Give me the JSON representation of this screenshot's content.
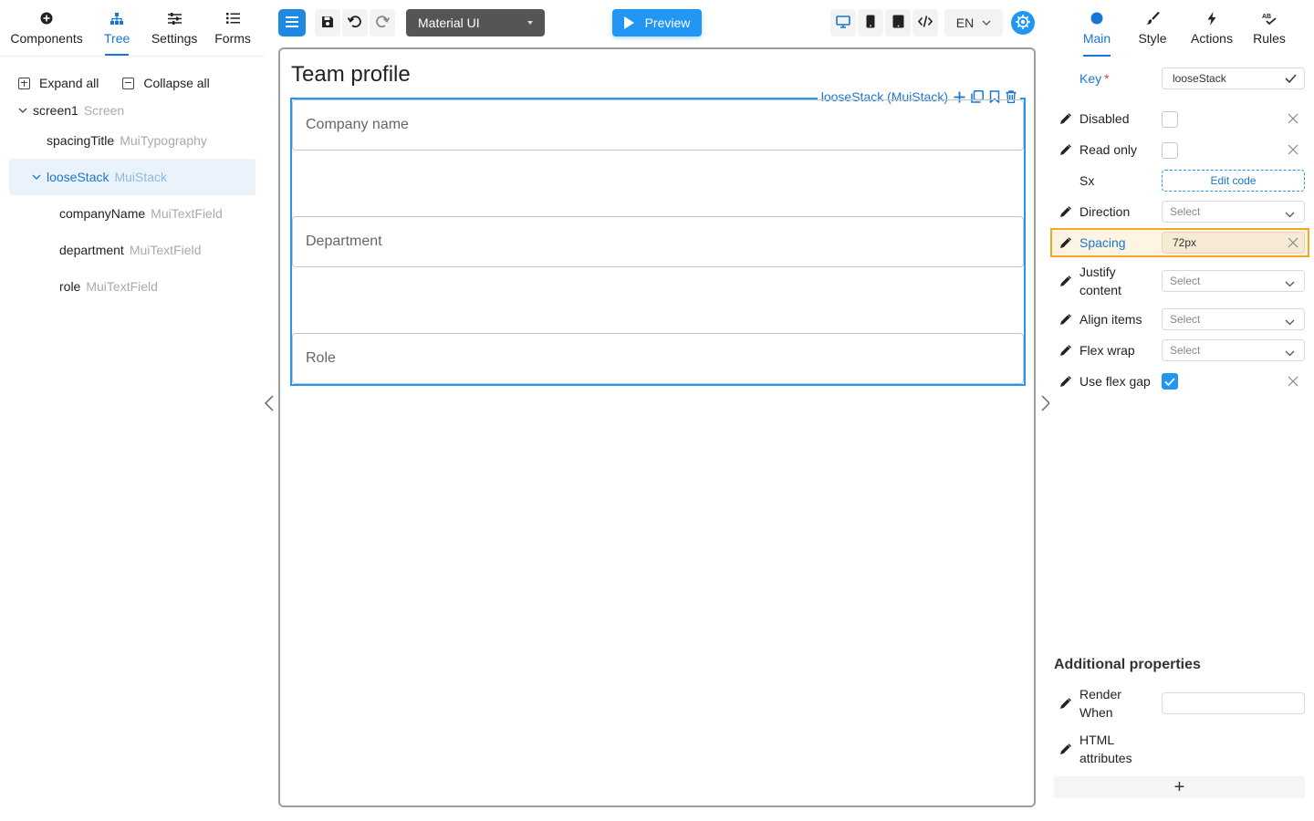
{
  "left_tabs": [
    {
      "label": "Components",
      "icon": "plus-circle-icon"
    },
    {
      "label": "Tree",
      "icon": "sitemap-icon"
    },
    {
      "label": "Settings",
      "icon": "sliders-icon"
    },
    {
      "label": "Forms",
      "icon": "list-icon"
    }
  ],
  "tree_actions": {
    "expand": "Expand all",
    "collapse": "Collapse all"
  },
  "tree": [
    {
      "name": "screen1",
      "type": "Screen"
    },
    {
      "name": "spacingTitle",
      "type": "MuiTypography"
    },
    {
      "name": "looseStack",
      "type": "MuiStack"
    },
    {
      "name": "companyName",
      "type": "MuiTextField"
    },
    {
      "name": "department",
      "type": "MuiTextField"
    },
    {
      "name": "role",
      "type": "MuiTextField"
    }
  ],
  "toolbar": {
    "framework": "Material UI",
    "preview": "Preview",
    "language": "EN"
  },
  "canvas": {
    "title": "Team profile",
    "stack_label": "looseStack (MuiStack)",
    "fields": [
      "Company name",
      "Department",
      "Role"
    ]
  },
  "right_tabs": [
    {
      "label": "Main",
      "icon": "circle-icon"
    },
    {
      "label": "Style",
      "icon": "brush-icon"
    },
    {
      "label": "Actions",
      "icon": "bolt-icon"
    },
    {
      "label": "Rules",
      "icon": "spellcheck-icon"
    }
  ],
  "props": {
    "key_label": "Key",
    "key_required": "*",
    "key_value": "looseStack",
    "disabled": "Disabled",
    "readonly": "Read only",
    "sx": "Sx",
    "sx_button": "Edit code",
    "direction": "Direction",
    "spacing": "Spacing",
    "spacing_value": "72px",
    "justify": "Justify content",
    "align": "Align items",
    "wrap": "Flex wrap",
    "flexgap": "Use flex gap",
    "select_placeholder": "Select",
    "use_flex_gap_checked": true
  },
  "additional": {
    "title": "Additional properties",
    "render_when": "Render When",
    "html_attrs": "HTML attributes",
    "add": "+"
  },
  "colors": {
    "accent": "#1976d2",
    "primary": "#2196f3",
    "highlight_border": "#f5a623",
    "highlight_bg": "#fdf4e3"
  }
}
